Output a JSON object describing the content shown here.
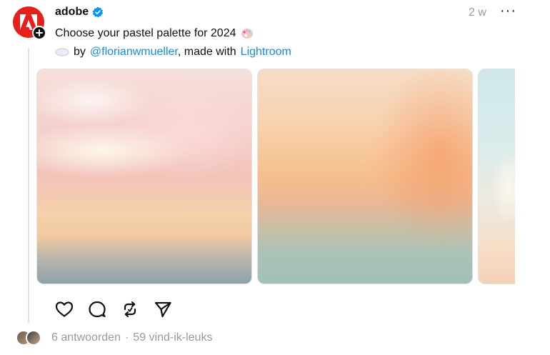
{
  "post": {
    "username": "adobe",
    "time": "2 w",
    "more_label": "···",
    "text_line1": "Choose your pastel palette for 2024",
    "by_label": "by",
    "mention": "@florianwmueller",
    "made_with": ", made with",
    "app_link": "Lightroom"
  },
  "footer": {
    "replies": "6 antwoorden",
    "separator": "·",
    "likes": "59 vind-ik-leuks"
  },
  "colors": {
    "accent": "#e8201c",
    "link": "#1a8cd8",
    "muted": "#9a9a9a",
    "verified": "#0095f6"
  },
  "icons": [
    "adobe-logo-icon",
    "plus-icon",
    "verified-badge-icon",
    "palette-icon",
    "cloud-icon",
    "heart-icon",
    "comment-icon",
    "repost-icon",
    "share-icon"
  ]
}
